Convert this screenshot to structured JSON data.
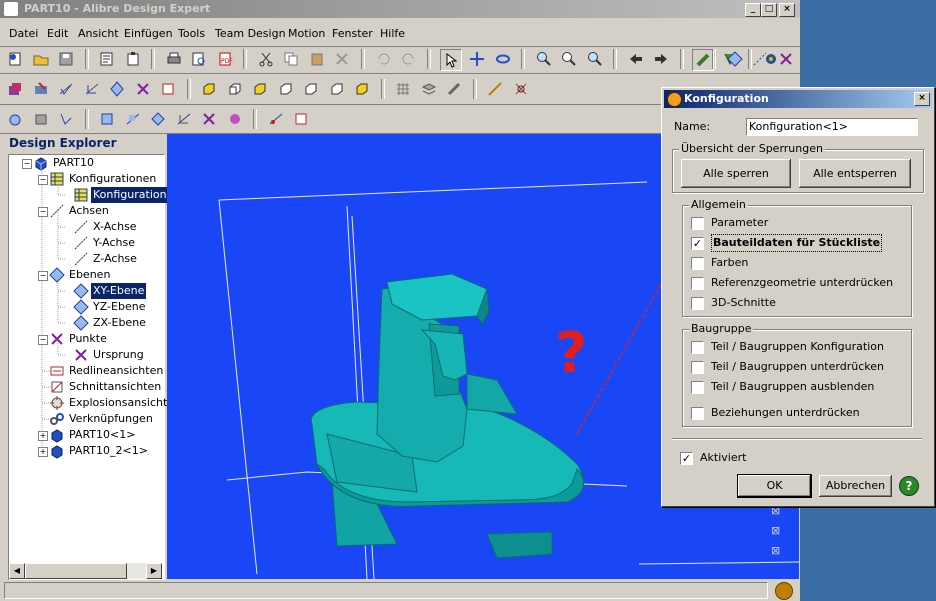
{
  "main_window": {
    "title": "PART10 - Alibre Design Expert",
    "menu": [
      "Datei",
      "Edit",
      "Ansicht",
      "Einfügen",
      "Tools",
      "Team Design",
      "Motion",
      "Fenster",
      "Hilfe"
    ]
  },
  "explorer": {
    "title": "Design Explorer",
    "tree": [
      {
        "label": "PART10",
        "icon": "part-icon"
      },
      {
        "label": "Konfigurationen",
        "icon": "table-icon"
      },
      {
        "label": "Konfiguration<",
        "icon": "table-icon"
      },
      {
        "label": "Achsen",
        "icon": "axis-icon"
      },
      {
        "label": "X-Achse",
        "icon": "axis-icon"
      },
      {
        "label": "Y-Achse",
        "icon": "axis-icon"
      },
      {
        "label": "Z-Achse",
        "icon": "axis-icon"
      },
      {
        "label": "Ebenen",
        "icon": "plane-icon"
      },
      {
        "label": "XY-Ebene",
        "icon": "plane-icon"
      },
      {
        "label": "YZ-Ebene",
        "icon": "plane-icon"
      },
      {
        "label": "ZX-Ebene",
        "icon": "plane-icon"
      },
      {
        "label": "Punkte",
        "icon": "point-icon"
      },
      {
        "label": "Ursprung",
        "icon": "point-icon"
      },
      {
        "label": "Redlineansichten",
        "icon": "redline-icon"
      },
      {
        "label": "Schnittansichten",
        "icon": "section-icon"
      },
      {
        "label": "Explosionsansichte",
        "icon": "explode-icon"
      },
      {
        "label": "Verknüpfungen",
        "icon": "link-icon"
      },
      {
        "label": "PART10<1>",
        "icon": "part-icon"
      },
      {
        "label": "PART10_2<1>",
        "icon": "part-icon"
      }
    ]
  },
  "annotation": {
    "mark": "?",
    "color": "#e0201c"
  },
  "dialog": {
    "title": "Konfiguration",
    "name_label": "Name:",
    "name_value": "Konfiguration<1>",
    "lock_group": "Übersicht der Sperrungen",
    "lock_all": "Alle sperren",
    "unlock_all": "Alle entsperren",
    "general_group": "Allgemein",
    "general_items": [
      {
        "label": "Parameter",
        "checked": false
      },
      {
        "label": "Bauteildaten für Stückliste",
        "checked": true
      },
      {
        "label": "Farben",
        "checked": false
      },
      {
        "label": "Referenzgeometrie unterdrücken",
        "checked": false
      },
      {
        "label": "3D-Schnitte",
        "checked": false
      }
    ],
    "assembly_group": "Baugruppe",
    "assembly_items": [
      {
        "label": "Teil / Baugruppen Konfiguration",
        "checked": false
      },
      {
        "label": "Teil / Baugruppen unterdrücken",
        "checked": false
      },
      {
        "label": "Teil / Baugruppen ausblenden",
        "checked": false
      },
      {
        "label": "Beziehungen unterdrücken",
        "checked": false
      }
    ],
    "activated_label": "Aktiviert",
    "activated": true,
    "ok": "OK",
    "cancel": "Abbrechen",
    "help": "?"
  },
  "colors": {
    "viewport": "#1a47f5",
    "model": "#14b7b7",
    "title_active": "#0a246a",
    "check_mark": "✓"
  }
}
